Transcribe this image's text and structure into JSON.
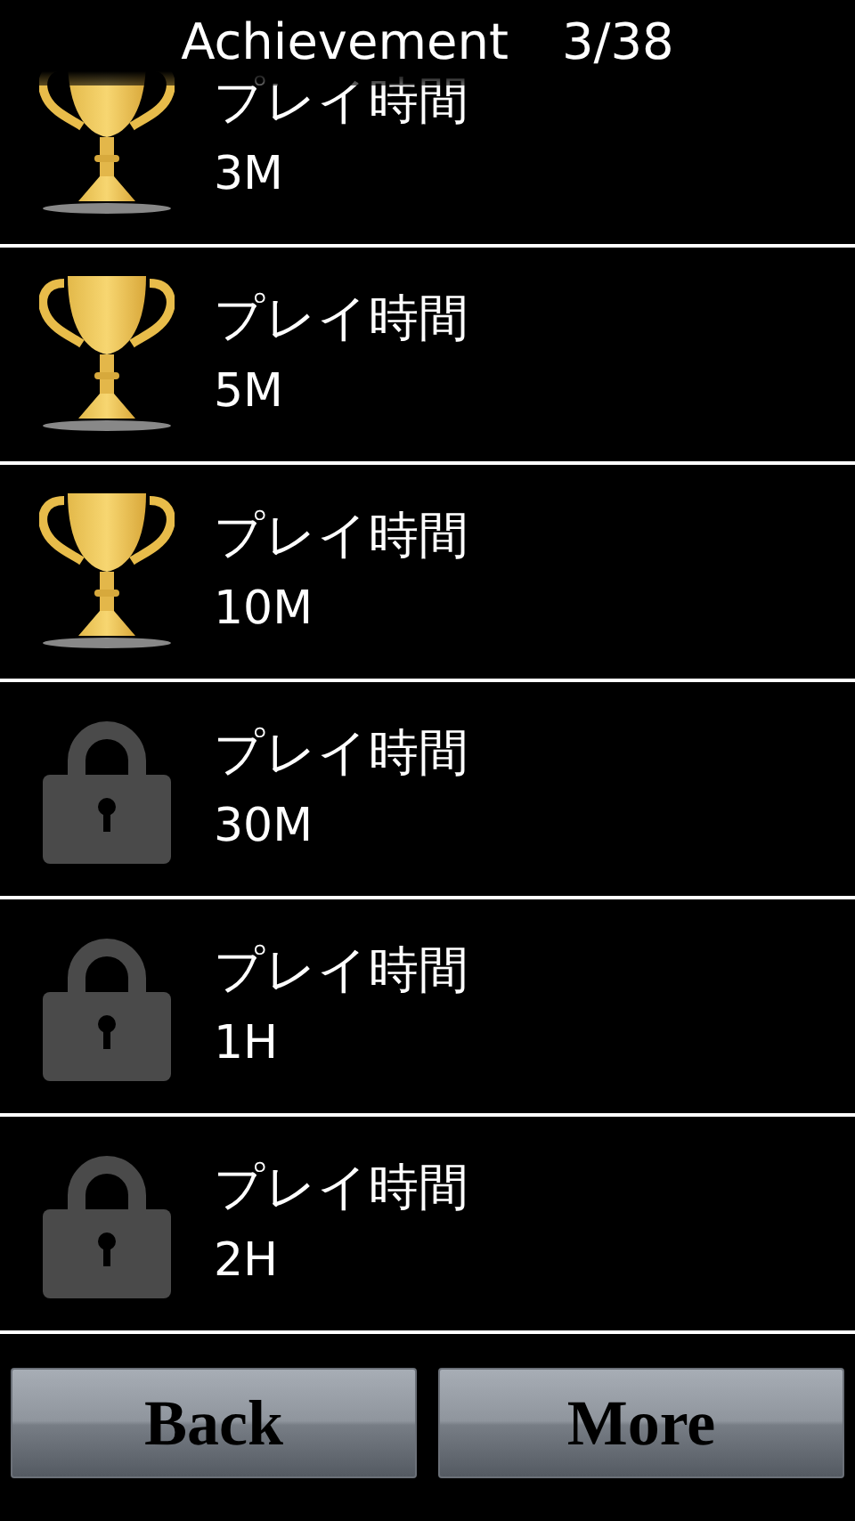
{
  "header": {
    "title": "Achievement",
    "count": "3/38"
  },
  "achievements": [
    {
      "title": "プレイ時間",
      "value": "3M",
      "unlocked": true
    },
    {
      "title": "プレイ時間",
      "value": "5M",
      "unlocked": true
    },
    {
      "title": "プレイ時間",
      "value": "10M",
      "unlocked": true
    },
    {
      "title": "プレイ時間",
      "value": "30M",
      "unlocked": false
    },
    {
      "title": "プレイ時間",
      "value": "1H",
      "unlocked": false
    },
    {
      "title": "プレイ時間",
      "value": "2H",
      "unlocked": false
    }
  ],
  "buttons": [
    "Back",
    "More"
  ]
}
